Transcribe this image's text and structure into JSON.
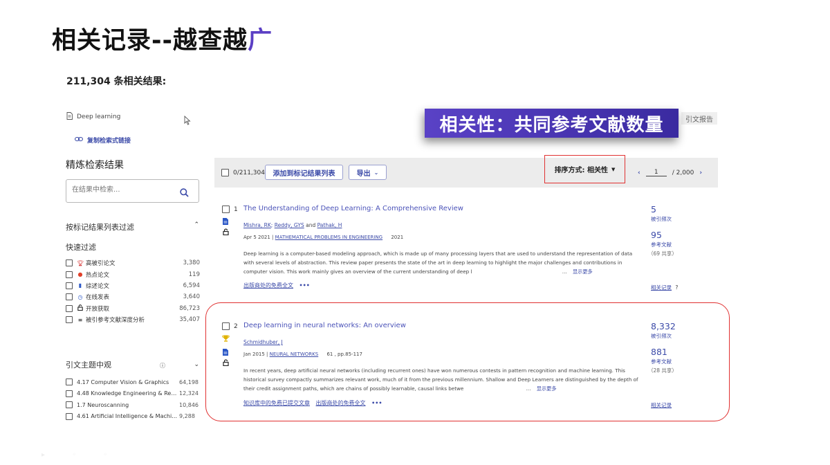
{
  "slide": {
    "title_main": "相关记录--越查越",
    "title_accent": "广"
  },
  "results": {
    "count_label": "211,304 条相关结果:"
  },
  "query": {
    "text": "Deep learning",
    "copy_link": "复制检索式链接"
  },
  "refine": {
    "title": "精炼检索结果",
    "search_placeholder": "在结果中检索...",
    "filter_by_marked": "按标记结果列表过滤",
    "quick_filter_title": "快速过滤",
    "quick_filters": [
      {
        "label": "高被引论文",
        "count": "3,380",
        "icon": "trophy-icon"
      },
      {
        "label": "热点论文",
        "count": "119",
        "icon": "flame-icon"
      },
      {
        "label": "综述论文",
        "count": "6,594",
        "icon": "document-icon"
      },
      {
        "label": "在线发表",
        "count": "3,640",
        "icon": "clock-icon"
      },
      {
        "label": "开放获取",
        "count": "86,723",
        "icon": "unlock-icon"
      },
      {
        "label": "被引参考文献深度分析",
        "count": "35,407",
        "icon": "list-icon"
      }
    ],
    "citation_topics_title": "引文主题中观",
    "citation_topics": [
      {
        "label": "4.17 Computer Vision & Graphics",
        "count": "64,198"
      },
      {
        "label": "4.48 Knowledge Engineering & Represe...",
        "count": "12,324"
      },
      {
        "label": "1.7 Neuroscanning",
        "count": "10,846"
      },
      {
        "label": "4.61 Artificial Intelligence & Machine Le...",
        "count": "9,288"
      }
    ]
  },
  "toolbar": {
    "selected": "0/211,304",
    "add_to_marked": "添加到标记结果列表",
    "export": "导出",
    "sort_label": "排序方式: 相关性",
    "page": "1",
    "total_pages": "/ 2,000",
    "citation_report": "引文报告"
  },
  "callout": {
    "text": "相关性：共同参考文献数量"
  },
  "records": [
    {
      "index": "1",
      "title": "The Understanding of Deep Learning: A Comprehensive Review",
      "authors": [
        "Mishra, RK",
        "Reddy, GYS",
        "Pathak, H"
      ],
      "and": "and",
      "date": "Apr 5 2021 |",
      "journal": "MATHEMATICAL PROBLEMS IN ENGINEERING",
      "extra": "2021",
      "abstract": "Deep learning is a computer-based modeling approach, which is made up of many processing layers that are used to understand the representation of data with several levels of abstraction. This review paper presents the state of the art in deep learning to highlight the major challenges and contributions in computer vision. This work mainly gives an overview of the current understanding of deep l",
      "ellipsis": "...",
      "show_more": "显示更多",
      "links": [
        "出版商处的免费全文"
      ],
      "times_cited": "5",
      "times_cited_label": "被引频次",
      "refs": "95",
      "refs_label": "参考文献",
      "shared": "（69 共享）",
      "related": "相关记录"
    },
    {
      "index": "2",
      "title": "Deep learning in neural networks: An overview",
      "authors": [
        "Schmidhuber, J"
      ],
      "and": "",
      "date": "Jan 2015 |",
      "journal": "NEURAL NETWORKS",
      "extra": "61 , pp.85-117",
      "abstract": "In recent years, deep artificial neural networks (including recurrent ones) have won numerous contests in pattern recognition and machine learning. This historical survey compactly summarizes relevant work, much of it from the previous millennium. Shallow and Deep Learners are distinguished by the depth of their credit assignment paths, which are chains of possibly learnable, causal links betwe",
      "ellipsis": "...",
      "show_more": "显示更多",
      "links": [
        "知识库中的免费已提交文章",
        "出版商处的免费全文"
      ],
      "times_cited": "8,332",
      "times_cited_label": "被引频次",
      "refs": "881",
      "refs_label": "参考文献",
      "shared": "（28 共享）",
      "related": "相关记录"
    }
  ],
  "colors": {
    "accent": "#5b3fc4",
    "link": "#3b4aa8",
    "highlight": "#e03030",
    "toolbar_bg": "#ececec"
  }
}
